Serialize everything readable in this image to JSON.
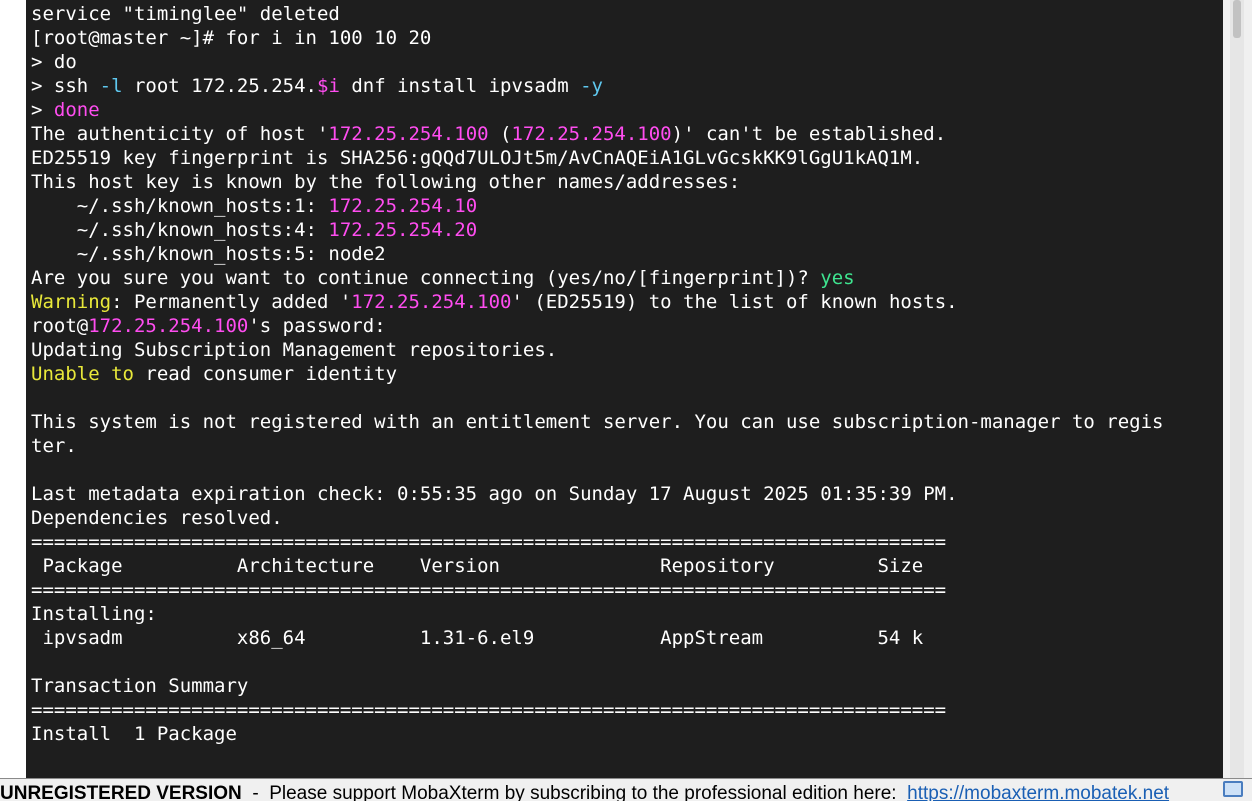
{
  "colors": {
    "background": "#1e1e1e",
    "foreground": "#ffffff",
    "magenta": "#ff4df0",
    "cyan": "#5fc8ef",
    "green": "#3ee48f",
    "yellow": "#e8e83a",
    "statusbar_bg": "#f0f0f0",
    "link": "#1a5fb4"
  },
  "terminal": {
    "lines": [
      [
        {
          "t": "service \"timinglee\" deleted",
          "c": "w"
        }
      ],
      [
        {
          "t": "[root@master ~]# for i in 100 10 20",
          "c": "w"
        }
      ],
      [
        {
          "t": "> do",
          "c": "w"
        }
      ],
      [
        {
          "t": "> ssh ",
          "c": "w"
        },
        {
          "t": "-l",
          "c": "c"
        },
        {
          "t": " root 172.25.254.",
          "c": "w"
        },
        {
          "t": "$i",
          "c": "m"
        },
        {
          "t": " dnf install ipvsadm ",
          "c": "w"
        },
        {
          "t": "-y",
          "c": "c"
        }
      ],
      [
        {
          "t": "> ",
          "c": "w"
        },
        {
          "t": "done",
          "c": "m"
        }
      ],
      [
        {
          "t": "The authenticity of host '",
          "c": "w"
        },
        {
          "t": "172.25.254.100",
          "c": "m"
        },
        {
          "t": " (",
          "c": "w"
        },
        {
          "t": "172.25.254.100",
          "c": "m"
        },
        {
          "t": ")' can't be established.",
          "c": "w"
        }
      ],
      [
        {
          "t": "ED25519 key fingerprint is SHA256:gQQd7ULOJt5m/AvCnAQEiA1GLvGcskKK9lGgU1kAQ1M.",
          "c": "w"
        }
      ],
      [
        {
          "t": "This host key is known by the following other names/addresses:",
          "c": "w"
        }
      ],
      [
        {
          "t": "    ~/.ssh/known_hosts:1: ",
          "c": "w"
        },
        {
          "t": "172.25.254.10",
          "c": "m"
        }
      ],
      [
        {
          "t": "    ~/.ssh/known_hosts:4: ",
          "c": "w"
        },
        {
          "t": "172.25.254.20",
          "c": "m"
        }
      ],
      [
        {
          "t": "    ~/.ssh/known_hosts:5: node2",
          "c": "w"
        }
      ],
      [
        {
          "t": "Are you sure you want to continue connecting (yes/no/[fingerprint])? ",
          "c": "w"
        },
        {
          "t": "yes",
          "c": "g"
        }
      ],
      [
        {
          "t": "Warning",
          "c": "y"
        },
        {
          "t": ": Permanently added '",
          "c": "w"
        },
        {
          "t": "172.25.254.100",
          "c": "m"
        },
        {
          "t": "' (ED25519) to the list of known hosts.",
          "c": "w"
        }
      ],
      [
        {
          "t": "root@",
          "c": "w"
        },
        {
          "t": "172.25.254.100",
          "c": "m"
        },
        {
          "t": "'s password:",
          "c": "w"
        }
      ],
      [
        {
          "t": "Updating Subscription Management repositories.",
          "c": "w"
        }
      ],
      [
        {
          "t": "Unable to",
          "c": "y"
        },
        {
          "t": " read consumer identity",
          "c": "w"
        }
      ],
      [],
      [
        {
          "t": "This system is not registered with an entitlement server. You can use subscription-manager to regis",
          "c": "w"
        }
      ],
      [
        {
          "t": "ter.",
          "c": "w"
        }
      ],
      [],
      [
        {
          "t": "Last metadata expiration check: 0:55:35 ago on Sunday 17 August 2025 01:35:39 PM.",
          "c": "w"
        }
      ],
      [
        {
          "t": "Dependencies resolved.",
          "c": "w"
        }
      ],
      [
        {
          "t": "================================================================================",
          "c": "w"
        }
      ],
      [
        {
          "t": " Package          Architecture    Version              Repository         Size",
          "c": "w"
        }
      ],
      [
        {
          "t": "================================================================================",
          "c": "w"
        }
      ],
      [
        {
          "t": "Installing:",
          "c": "w"
        }
      ],
      [
        {
          "t": " ipvsadm          x86_64          1.31-6.el9           AppStream          54 k",
          "c": "w"
        }
      ],
      [],
      [
        {
          "t": "Transaction Summary",
          "c": "w"
        }
      ],
      [
        {
          "t": "================================================================================",
          "c": "w"
        }
      ],
      [
        {
          "t": "Install  1 Package",
          "c": "w"
        }
      ]
    ]
  },
  "statusbar": {
    "unregistered": "UNREGISTERED VERSION",
    "separator": "  -  ",
    "message": "Please support MobaXterm by subscribing to the professional edition here:  ",
    "link": "https://mobaxterm.mobatek.net"
  },
  "icons": {
    "statusbar_icon": "chat-bubble-icon"
  }
}
